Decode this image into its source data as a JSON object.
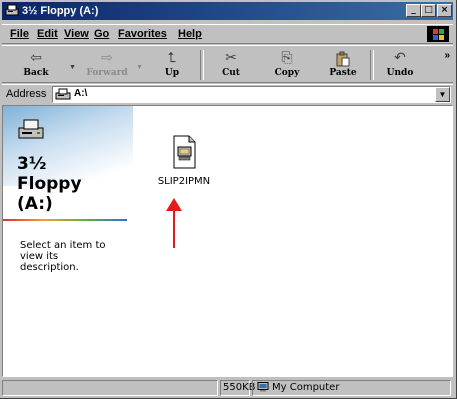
{
  "window": {
    "title": "3½ Floppy (A:)"
  },
  "caption_buttons": {
    "minimize": "_",
    "maximize": "□",
    "close": "×"
  },
  "menu": {
    "items": [
      {
        "label": "File",
        "key": "F"
      },
      {
        "label": "Edit",
        "key": "E"
      },
      {
        "label": "View",
        "key": "V"
      },
      {
        "label": "Go",
        "key": "G"
      },
      {
        "label": "Favorites",
        "key": "a"
      },
      {
        "label": "Help",
        "key": "H"
      }
    ]
  },
  "toolbar": {
    "back": {
      "label": "Back",
      "icon": "back-arrow-icon",
      "glyph": "⇦"
    },
    "forward": {
      "label": "Forward",
      "icon": "forward-arrow-icon",
      "glyph": "⇨"
    },
    "up": {
      "label": "Up",
      "icon": "up-folder-icon",
      "glyph": "⮤"
    },
    "cut": {
      "label": "Cut",
      "icon": "scissors-icon",
      "glyph": "✂"
    },
    "copy": {
      "label": "Copy",
      "icon": "copy-icon",
      "glyph": "⎘"
    },
    "paste": {
      "label": "Paste",
      "icon": "paste-icon",
      "glyph": "📋"
    },
    "undo": {
      "label": "Undo",
      "icon": "undo-icon",
      "glyph": "↶"
    },
    "more": "»"
  },
  "address": {
    "label": "Address",
    "value": "A:\\"
  },
  "left_pane": {
    "title_line1": "3½",
    "title_line2": "Floppy",
    "title_line3": "(A:)",
    "description": "Select an item to view its description."
  },
  "files": [
    {
      "name": "SLIP2IPMN",
      "icon": "batch-file-icon"
    }
  ],
  "status": {
    "size": "550KB",
    "zone": "My Computer"
  },
  "colors": {
    "titlebar_start": "#0a246a",
    "titlebar_end": "#3a6ea5",
    "annotation_arrow": "#e31b1b",
    "face": "#c0c0c0"
  }
}
